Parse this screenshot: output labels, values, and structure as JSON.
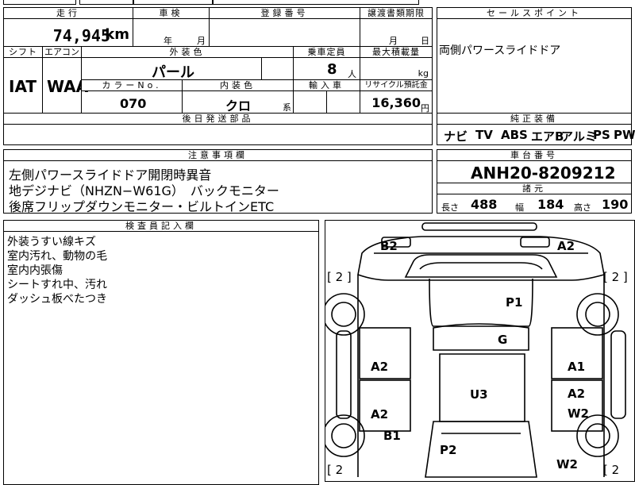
{
  "top_strip": {
    "cut_text_1": "",
    "cut_text_2": "",
    "cut_text_3": ""
  },
  "mileage": {
    "label": "走行",
    "value": "74,945",
    "unit": "km"
  },
  "inspection": {
    "label": "車検",
    "year_unit": "年",
    "month_unit": "月"
  },
  "registration": {
    "label": "登録番号",
    "value": ""
  },
  "transfer_deadline": {
    "label": "譲渡書類期限",
    "month_unit": "月",
    "day_unit": "日"
  },
  "sales_point": {
    "label": "セールスポイント",
    "value": "両側パワースライドドア"
  },
  "shift": {
    "label": "シフト",
    "value": "IAT"
  },
  "aircon": {
    "label": "エアコン",
    "value": "WAA"
  },
  "exterior_color": {
    "label": "外装色",
    "value": "パール"
  },
  "capacity": {
    "label": "乗車定員",
    "value": "8",
    "unit": "人"
  },
  "max_load": {
    "label": "最大積載量",
    "value": "",
    "unit": "kg"
  },
  "color_no": {
    "label": "カラーNo.",
    "value": "070"
  },
  "interior_color": {
    "label": "内装色",
    "value": "クロ",
    "unit": "系"
  },
  "import": {
    "label": "輸入車",
    "value": ""
  },
  "recycle": {
    "label": "リサイクル預託金",
    "value": "16,360",
    "unit": "円"
  },
  "later_parts": {
    "label": "後日発送部品",
    "value": ""
  },
  "genuine_equipment": {
    "label": "純正装備",
    "items": [
      "ナビ",
      "TV",
      "ABS",
      "エアB",
      "アルミ",
      "PS",
      "PW"
    ]
  },
  "notes": {
    "label": "注意事項欄",
    "lines": [
      "左側パワースライドドア開閉時異音",
      "地デジナビ（NHZN−W61G）　バックモニター",
      "後席フリップダウンモニター・ビルトインETC"
    ]
  },
  "chassis_no": {
    "label": "車台番号",
    "value": "ANH20-8209212"
  },
  "dimensions": {
    "label": "諸元",
    "length_label": "長さ",
    "length": "488",
    "width_label": "幅",
    "width": "184",
    "height_label": "高さ",
    "height": "190"
  },
  "inspector_notes": {
    "label": "検査員記入欄",
    "lines": [
      "外装うすい線キズ",
      "室内汚れ、動物の毛",
      "室内内張傷",
      "シートすれ中、汚れ",
      "ダッシュ板べたつき"
    ]
  },
  "diagram": {
    "marks": {
      "b2": "B2",
      "a2_top": "A2",
      "p1": "P1",
      "g": "G",
      "a2_left1": "A2",
      "a1": "A1",
      "u3": "U3",
      "a2_right": "A2",
      "a2_left2": "A2",
      "w2_right": "W2",
      "b1": "B1",
      "p2": "P2",
      "w2_bottom": "W2"
    },
    "tire_labels": {
      "tl": "[ 2 ]",
      "tr": "[ 2 ]",
      "bl": "[ 2",
      "br": "[ 2"
    }
  }
}
